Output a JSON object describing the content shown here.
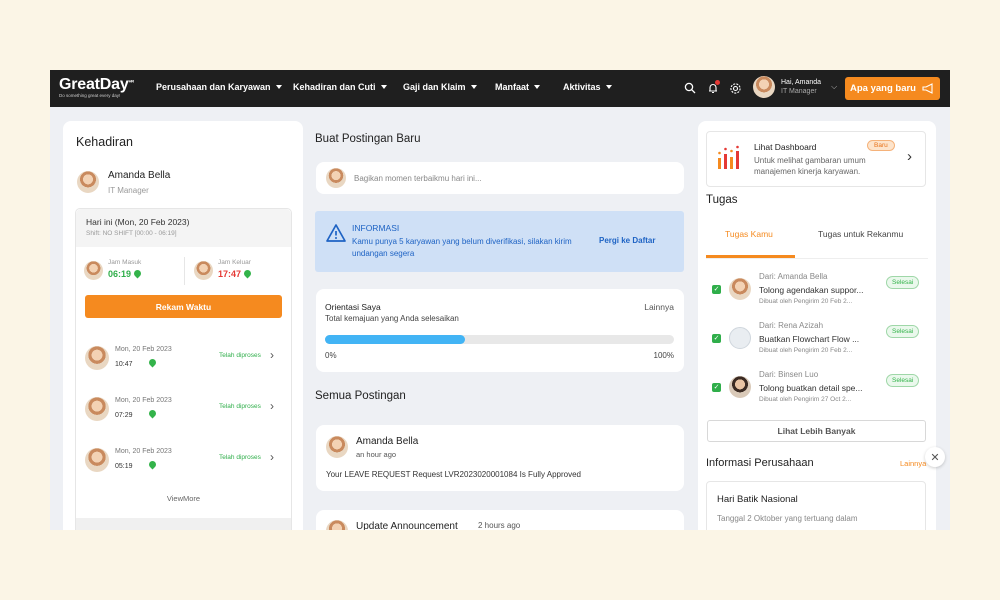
{
  "logo": {
    "name": "GreatDay",
    "superscript": "HR",
    "tagline": "Do something great every day!"
  },
  "nav": [
    {
      "label": "Perusahaan dan Karyawan"
    },
    {
      "label": "Kehadiran dan Cuti"
    },
    {
      "label": "Gaji dan Klaim"
    },
    {
      "label": "Manfaat"
    },
    {
      "label": "Aktivitas"
    }
  ],
  "user": {
    "greeting": "Hai, Amanda",
    "role": "IT Manager"
  },
  "whats_new": "Apa yang baru",
  "attendance": {
    "title": "Kehadiran",
    "name": "Amanda Bella",
    "role": "IT Manager",
    "today": "Hari ini (Mon, 20 Feb 2023)",
    "shift": "Shift: NO SHIFT [00:00 - 06:19]",
    "clock_in_label": "Jam Masuk",
    "clock_in": "06:19",
    "clock_out_label": "Jam Keluar",
    "clock_out": "17:47",
    "record_button": "Rekam Waktu",
    "records": [
      {
        "date": "Mon, 20 Feb 2023",
        "time": "10:47",
        "status": "Telah diproses"
      },
      {
        "date": "Mon, 20 Feb 2023",
        "time": "07:29",
        "status": "Telah diproses"
      },
      {
        "date": "Mon, 20 Feb 2023",
        "time": "05:19",
        "status": "Telah diproses"
      }
    ],
    "view_more": "ViewMore"
  },
  "feed": {
    "new_post_title": "Buat Postingan Baru",
    "post_placeholder": "Bagikan momen terbaikmu hari ini...",
    "info_title": "INFORMASI",
    "info_text": "Kamu punya 5 karyawan yang belum diverifikasi, silakan kirim undangan segera",
    "info_link": "Pergi ke Daftar",
    "orientation_title": "Orientasi Saya",
    "orientation_more": "Lainnya",
    "orientation_sub": "Total kemajuan yang Anda selesaikan",
    "progress_min": "0%",
    "progress_max": "100%",
    "progress_value": 0.4,
    "all_posts_title": "Semua Postingan",
    "posts": [
      {
        "author": "Amanda Bella",
        "time": "an hour ago",
        "text": "Your LEAVE REQUEST Request LVR2023020001084 Is Fully Approved"
      },
      {
        "author": "Update Announcement",
        "time": "2 hours ago",
        "text": ""
      }
    ]
  },
  "dashboard": {
    "title": "Lihat Dashboard",
    "badge": "Baru",
    "desc": "Untuk melihat gambaran umum manajemen kinerja karyawan."
  },
  "tasks": {
    "title": "Tugas",
    "tab_mine": "Tugas Kamu",
    "tab_colleague": "Tugas untuk Rekanmu",
    "items": [
      {
        "from": "Dari: Amanda Bella",
        "title": "Tolong agendakan suppor...",
        "meta": "Dibuat oleh Pengirim 20 Feb 2...",
        "status": "Selesai"
      },
      {
        "from": "Dari: Rena Azizah",
        "title": "Buatkan Flowchart Flow ...",
        "meta": "Dibuat oleh Pengirim 20 Feb 2...",
        "status": "Selesai"
      },
      {
        "from": "Dari: Binsen Luo",
        "title": "Tolong buatkan detail spe...",
        "meta": "Dibuat oleh Pengirim 27 Oct 2...",
        "status": "Selesai"
      }
    ],
    "see_more": "Lihat Lebih Banyak"
  },
  "company_info": {
    "title": "Informasi Perusahaan",
    "more": "Lainnya",
    "item_title": "Hari Batik Nasional",
    "item_text": "Tanggal 2 Oktober yang tertuang dalam"
  },
  "colors": {
    "accent": "#f58a1f",
    "nav_bg": "#1f1f1f",
    "info_bg": "#cfe0f6",
    "progress": "#42b4f5",
    "success": "#33b34a"
  }
}
